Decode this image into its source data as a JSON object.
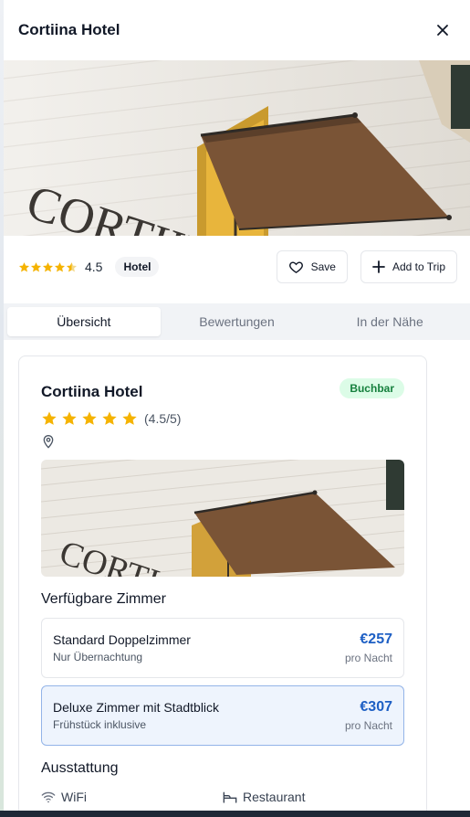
{
  "header": {
    "title": "Cortiina Hotel",
    "close_icon": "close-icon"
  },
  "meta": {
    "rating": "4.5",
    "type": "Hotel",
    "save_label": "Save",
    "add_trip_label": "Add to Trip"
  },
  "tabs": [
    {
      "label": "Übersicht",
      "active": true
    },
    {
      "label": "Bewertungen",
      "active": false
    },
    {
      "label": "In der Nähe",
      "active": false
    }
  ],
  "card": {
    "title": "Cortiina Hotel",
    "status": "Buchbar",
    "rating_text": "(4.5/5)",
    "rooms_title": "Verfügbare Zimmer",
    "rooms": [
      {
        "name": "Standard Doppelzimmer",
        "sub": "Nur Übernachtung",
        "price": "€257",
        "per": "pro Nacht",
        "selected": false
      },
      {
        "name": "Deluxe Zimmer mit Stadtblick",
        "sub": "Frühstück inklusive",
        "price": "€307",
        "per": "pro Nacht",
        "selected": true
      }
    ],
    "amenities_title": "Ausstattung",
    "amenities": [
      {
        "label": "WiFi",
        "icon": "wifi-icon"
      },
      {
        "label": "Restaurant",
        "icon": "bed-icon"
      }
    ]
  },
  "colors": {
    "star": "#f5b301",
    "price": "#1d5fc4",
    "bookable_bg": "#dcfce7",
    "bookable_text": "#15803d"
  }
}
